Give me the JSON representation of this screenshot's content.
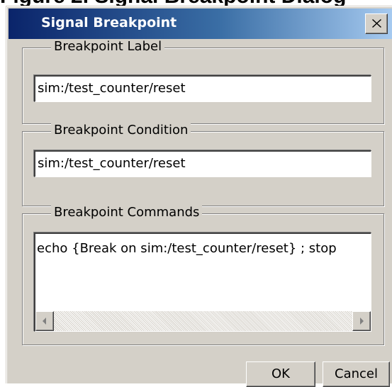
{
  "dialog": {
    "title": "Signal Breakpoint",
    "close_glyph": "✕"
  },
  "label_group": {
    "legend": "Breakpoint Label",
    "value": "sim:/test_counter/reset"
  },
  "condition_group": {
    "legend": "Breakpoint Condition",
    "value": "sim:/test_counter/reset"
  },
  "commands_group": {
    "legend": "Breakpoint Commands",
    "value": "echo {Break on sim:/test_counter/reset} ; stop"
  },
  "buttons": {
    "ok": "OK",
    "cancel": "Cancel"
  },
  "icons": {
    "close": "close-icon",
    "scroll_left": "scroll-left-arrow-icon",
    "scroll_right": "scroll-right-arrow-icon"
  },
  "colors": {
    "title_bar_start": "#0a246a",
    "title_bar_end": "#a6caf0",
    "dialog_face": "#d4d0c8"
  }
}
